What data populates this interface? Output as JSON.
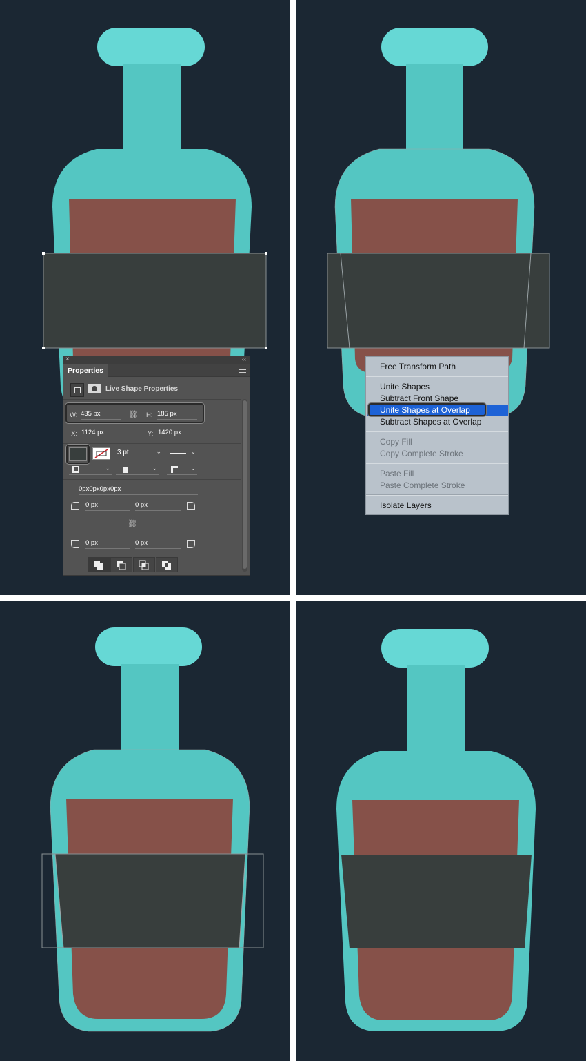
{
  "colors": {
    "background": "#1b2733",
    "bottle": "#54c6c2",
    "bottle_cap": "#66d8d5",
    "liquid": "#865149",
    "label": "#383e3d",
    "menu_highlight": "#1d62d6"
  },
  "properties_panel": {
    "tab_label": "Properties",
    "section_title": "Live Shape Properties",
    "w_label": "W:",
    "w_value": "435 px",
    "h_label": "H:",
    "h_value": "185 px",
    "x_label": "X:",
    "x_value": "1124 px",
    "y_label": "Y:",
    "y_value": "1420 px",
    "stroke_width": "3 pt",
    "corner_summary": "0px0px0px0px",
    "corner_tl": "0 px",
    "corner_tr": "0 px",
    "corner_bl": "0 px",
    "corner_br": "0 px",
    "icons": {
      "close": "×",
      "collapse": "‹‹",
      "link": "⛓",
      "chevron": "⌄"
    }
  },
  "context_menu": {
    "items": [
      "Free Transform Path",
      "Unite Shapes",
      "Subtract Front Shape",
      "Unite Shapes at Overlap",
      "Subtract Shapes at Overlap",
      "Copy Fill",
      "Copy Complete Stroke",
      "Paste Fill",
      "Paste Complete Stroke",
      "Isolate Layers"
    ],
    "selected": "Unite Shapes at Overlap"
  }
}
